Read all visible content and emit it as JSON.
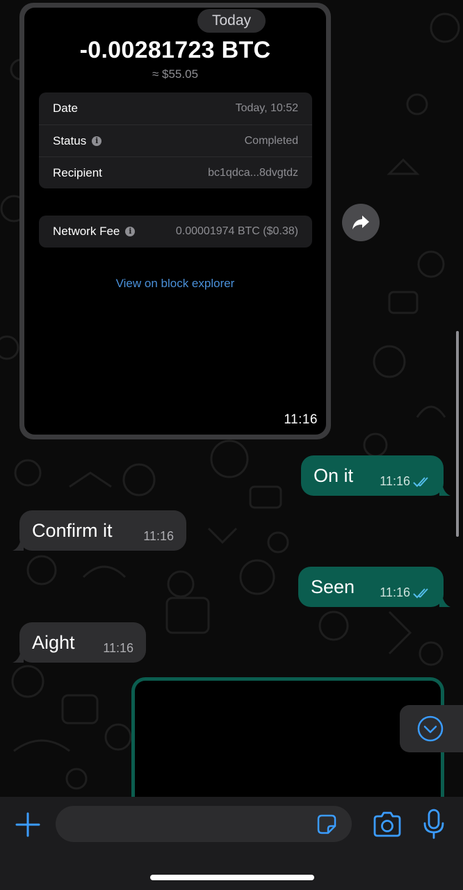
{
  "date_separator": "Today",
  "screenshot": {
    "amount": "-0.00281723 BTC",
    "fiat": "≈ $55.05",
    "details": [
      {
        "label": "Date",
        "value": "Today, 10:52"
      },
      {
        "label": "Status",
        "value": "Completed"
      },
      {
        "label": "Recipient",
        "value": "bc1qdca...8dvgtdz"
      }
    ],
    "fee": {
      "label": "Network Fee",
      "value": "0.00001974 BTC ($0.38)"
    },
    "explorer_link": "View on block explorer",
    "time": "11:16"
  },
  "messages": [
    {
      "direction": "outgoing",
      "text": "On it",
      "time": "11:16",
      "status": "read"
    },
    {
      "direction": "incoming",
      "text": "Confirm it",
      "time": "11:16"
    },
    {
      "direction": "outgoing",
      "text": "Seen",
      "time": "11:16",
      "status": "read"
    },
    {
      "direction": "incoming",
      "text": "Aight",
      "time": "11:16"
    }
  ],
  "composer": {
    "placeholder": "",
    "value": ""
  },
  "icons": {
    "forward": "forward-arrow-icon",
    "scroll_down": "chevron-down-circle-icon",
    "add": "plus-icon",
    "sticker": "sticker-icon",
    "camera": "camera-icon",
    "mic": "microphone-icon",
    "read_receipt": "double-check-icon"
  },
  "colors": {
    "outgoing_bubble": "#0b5d4f",
    "incoming_bubble": "#2e2e30",
    "accent": "#3b9cff",
    "read_check": "#53bdeb"
  }
}
